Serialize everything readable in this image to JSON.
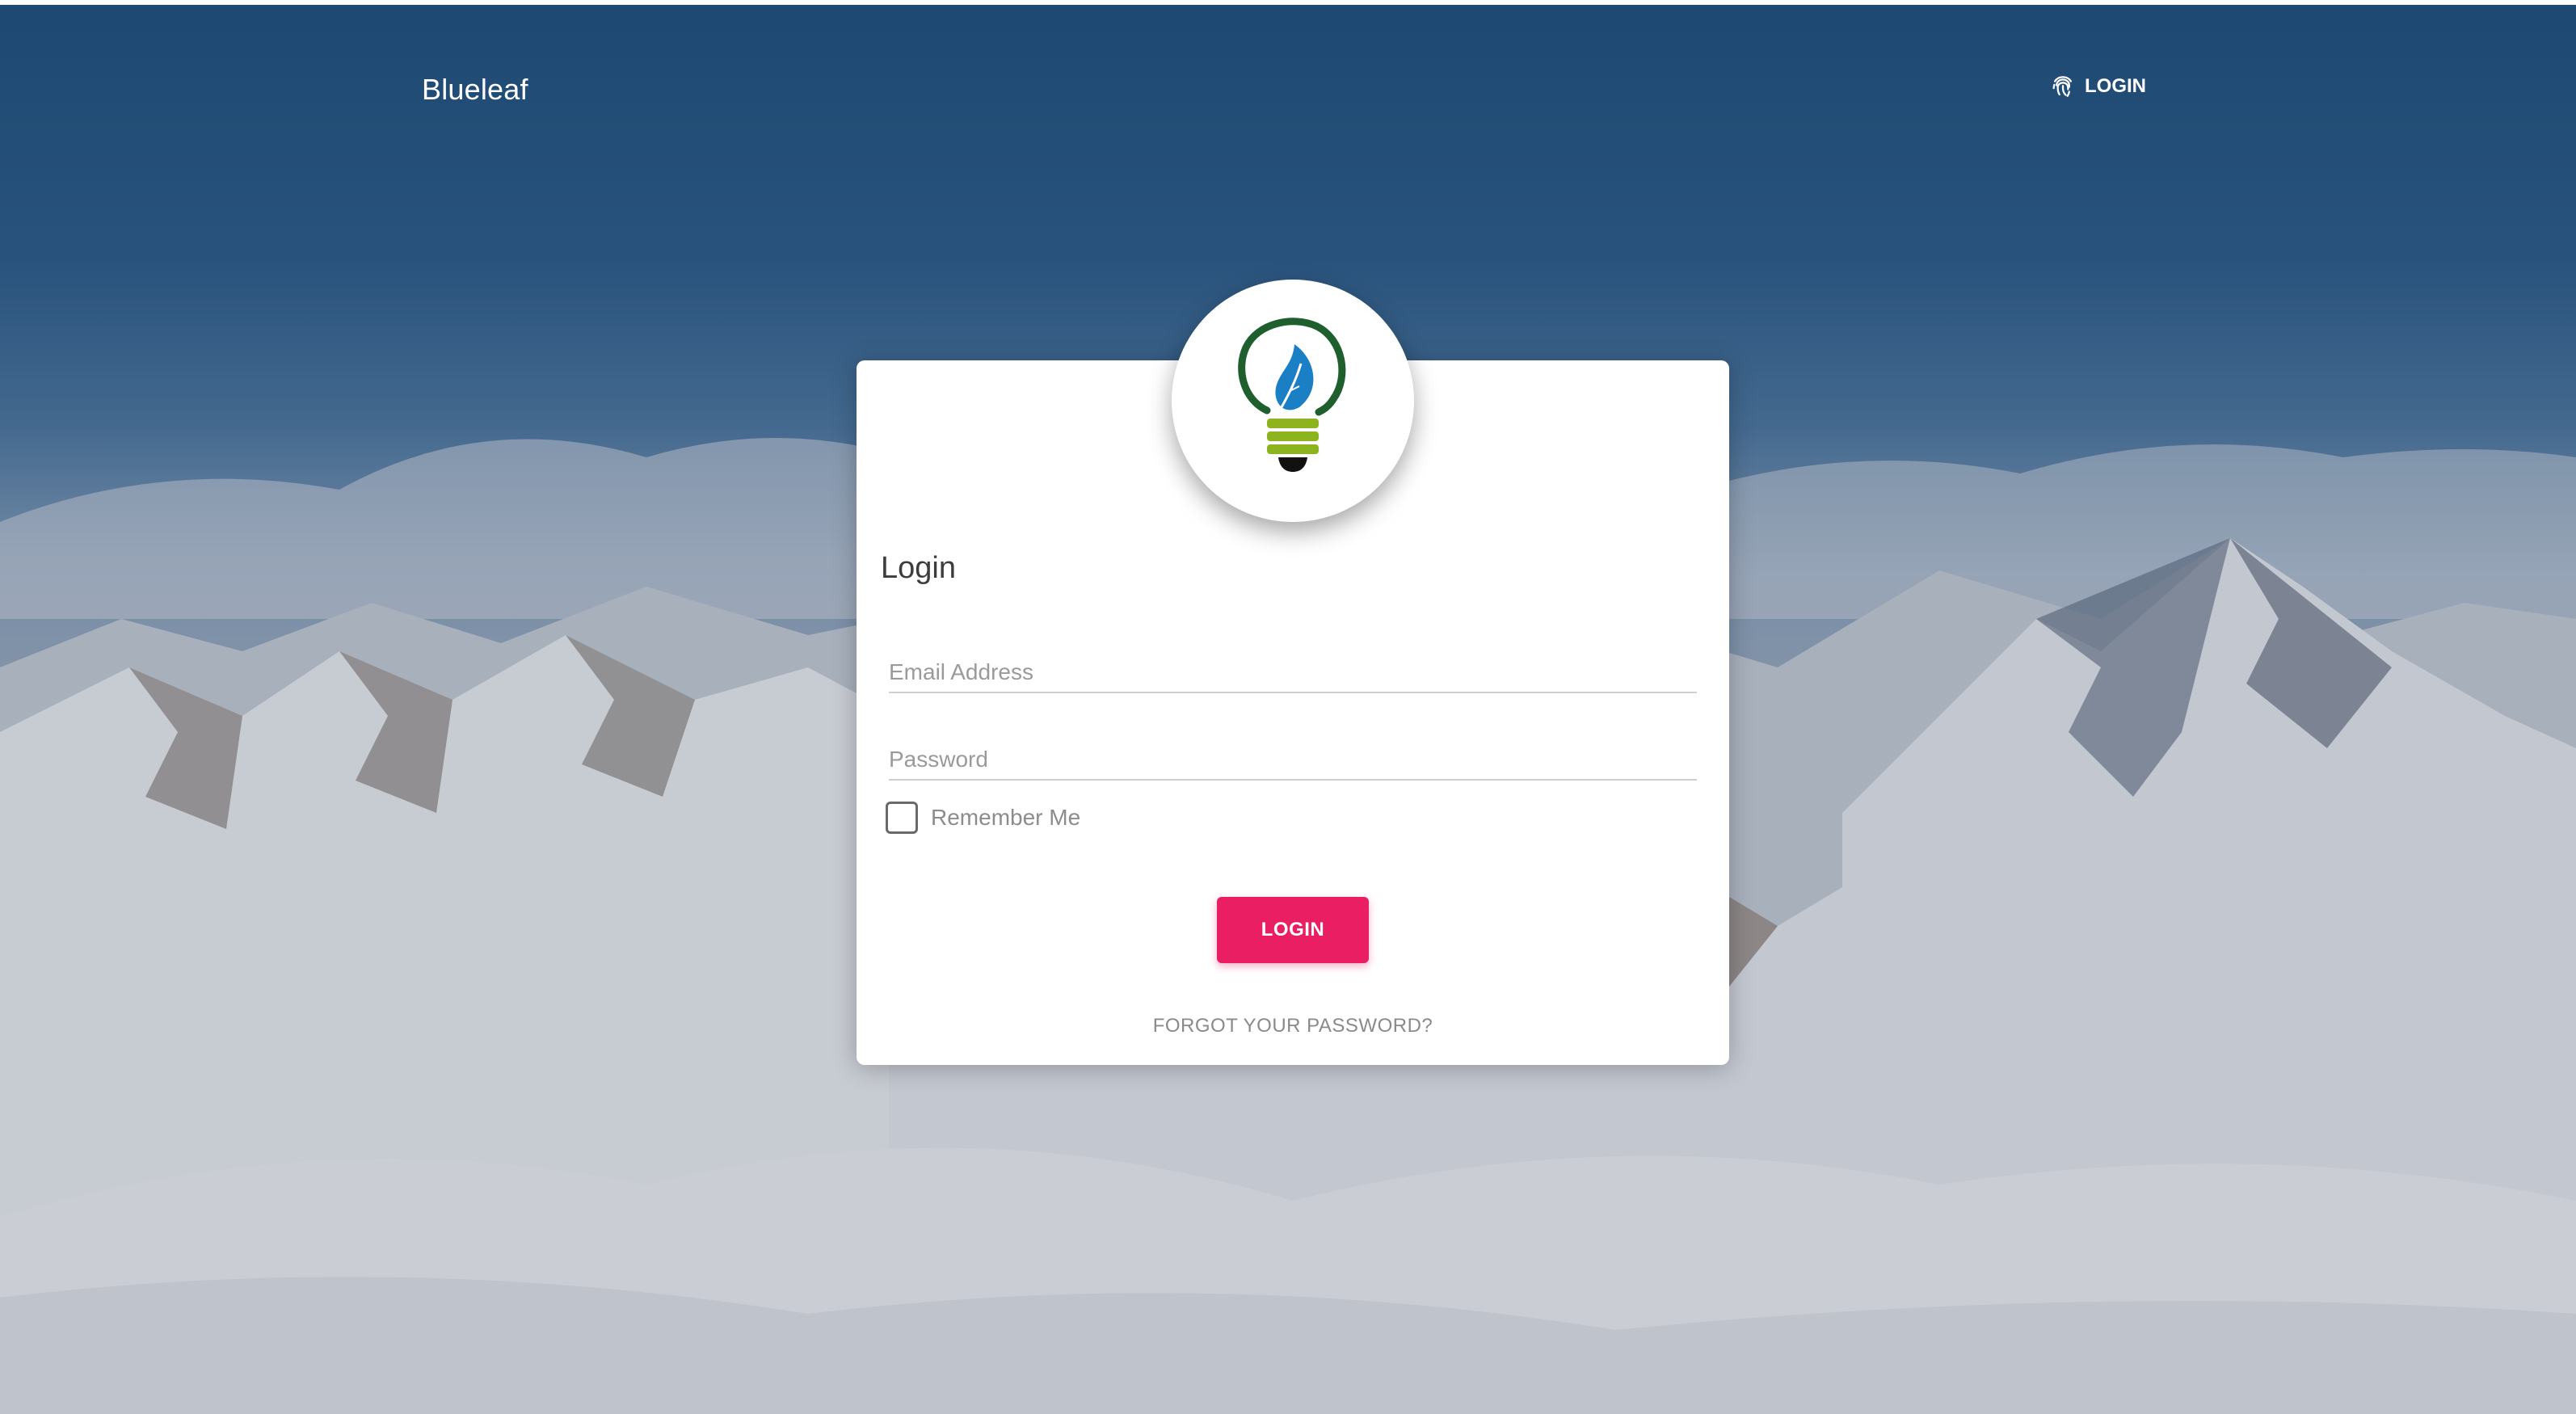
{
  "header": {
    "brand": "Blueleaf",
    "login_link": "LOGIN",
    "login_icon": "fingerprint-icon"
  },
  "login_card": {
    "logo": "blueleaf-lightbulb-logo",
    "title": "Login",
    "email": {
      "placeholder": "Email Address",
      "value": ""
    },
    "password": {
      "placeholder": "Password",
      "value": ""
    },
    "remember_me": {
      "label": "Remember Me",
      "checked": false
    },
    "submit_label": "LOGIN",
    "forgot_label": "FORGOT YOUR PASSWORD?"
  },
  "colors": {
    "accent": "#e91e63",
    "logo_leaf": "#1a7fc4",
    "logo_ring": "#1f5f2e",
    "logo_base": "#8db41e"
  }
}
